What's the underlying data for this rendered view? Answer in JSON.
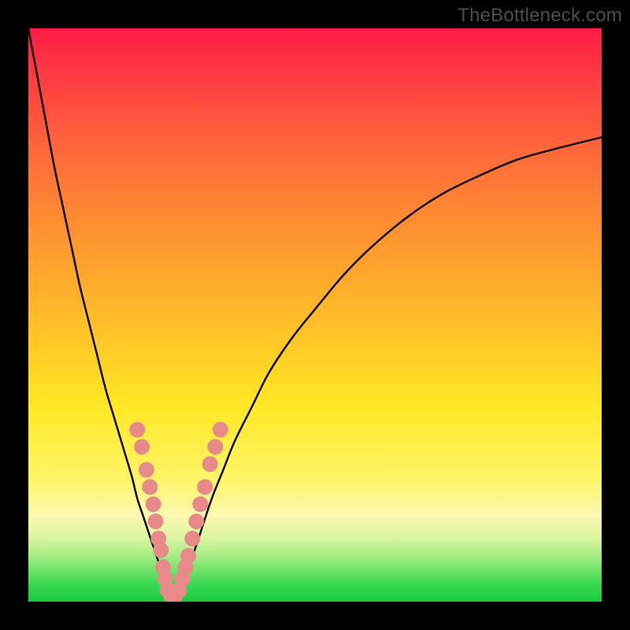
{
  "watermark": "TheBottleneck.com",
  "chart_data": {
    "type": "line",
    "title": "",
    "xlabel": "",
    "ylabel": "",
    "xlim": [
      0,
      100
    ],
    "ylim": [
      0,
      100
    ],
    "background_gradient": {
      "orientation": "vertical",
      "stops": [
        {
          "pos": 0,
          "color": "#ff1b47"
        },
        {
          "pos": 22,
          "color": "#ff6a3a"
        },
        {
          "pos": 52,
          "color": "#ffc028"
        },
        {
          "pos": 79,
          "color": "#fff56a"
        },
        {
          "pos": 88,
          "color": "#e4f6a6"
        },
        {
          "pos": 100,
          "color": "#18cc3e"
        }
      ]
    },
    "series": [
      {
        "name": "left-curve",
        "stroke": "#000000",
        "x": [
          0.0,
          1.5,
          3.0,
          4.5,
          6.0,
          7.5,
          9.0,
          10.5,
          12.0,
          13.5,
          15.0,
          16.5,
          18.0,
          19.0,
          20.0,
          21.0,
          22.0,
          23.0,
          23.5,
          24.0,
          24.5
        ],
        "y": [
          100,
          92,
          84,
          76,
          69,
          62,
          55,
          49,
          43,
          37,
          32,
          27,
          22,
          18,
          15,
          12,
          9,
          6,
          4,
          2,
          0
        ]
      },
      {
        "name": "right-curve",
        "stroke": "#000000",
        "x": [
          26.0,
          27.0,
          28.0,
          29.0,
          30.0,
          32.0,
          34.0,
          36.0,
          39.0,
          42.0,
          46.0,
          50.0,
          55.0,
          60.0,
          66.0,
          72.0,
          78.0,
          85.0,
          92.0,
          100.0
        ],
        "y": [
          0,
          3,
          6,
          9,
          12,
          18,
          23,
          28,
          34,
          40,
          46,
          51,
          57,
          62,
          67,
          71,
          74,
          77,
          79,
          81
        ]
      }
    ],
    "markers": {
      "name": "pink-dots",
      "color": "#e98a8a",
      "radius_px": 10,
      "points": [
        {
          "x": 19.0,
          "y": 30
        },
        {
          "x": 19.8,
          "y": 27
        },
        {
          "x": 20.6,
          "y": 23
        },
        {
          "x": 21.2,
          "y": 20
        },
        {
          "x": 21.8,
          "y": 17
        },
        {
          "x": 22.2,
          "y": 14
        },
        {
          "x": 22.7,
          "y": 11
        },
        {
          "x": 23.1,
          "y": 9
        },
        {
          "x": 23.5,
          "y": 6
        },
        {
          "x": 23.9,
          "y": 4
        },
        {
          "x": 24.3,
          "y": 2
        },
        {
          "x": 24.9,
          "y": 1
        },
        {
          "x": 25.6,
          "y": 1
        },
        {
          "x": 26.3,
          "y": 2
        },
        {
          "x": 26.9,
          "y": 4
        },
        {
          "x": 27.4,
          "y": 6
        },
        {
          "x": 27.9,
          "y": 8
        },
        {
          "x": 28.6,
          "y": 11
        },
        {
          "x": 29.3,
          "y": 14
        },
        {
          "x": 30.0,
          "y": 17
        },
        {
          "x": 30.8,
          "y": 20
        },
        {
          "x": 31.7,
          "y": 24
        },
        {
          "x": 32.6,
          "y": 27
        },
        {
          "x": 33.5,
          "y": 30
        }
      ]
    }
  }
}
